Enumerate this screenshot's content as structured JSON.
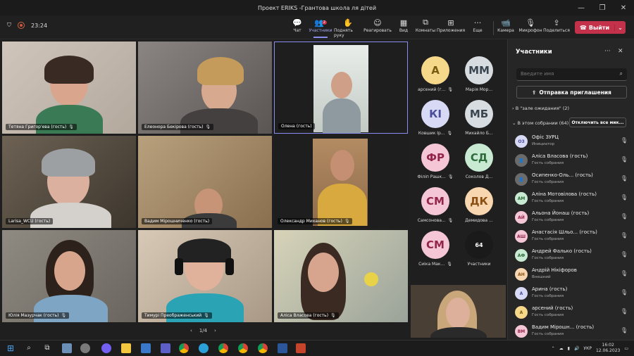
{
  "window": {
    "title": "Проект ERIKS -Грантова школа ля дітей"
  },
  "toolbar": {
    "time": "23:24",
    "buttons": [
      {
        "label": "Чат",
        "icon": "chat-icon"
      },
      {
        "label": "Участники",
        "icon": "people-icon",
        "badge": "2"
      },
      {
        "label": "Поднять руку",
        "icon": "hand-icon"
      },
      {
        "label": "Реагировать",
        "icon": "smile-icon"
      },
      {
        "label": "Вид",
        "icon": "grid-icon"
      },
      {
        "label": "Комнаты",
        "icon": "rooms-icon"
      },
      {
        "label": "Приложения",
        "icon": "plus-icon"
      },
      {
        "label": "Еще",
        "icon": "more-icon"
      },
      {
        "label": "Камера",
        "icon": "camera-icon"
      },
      {
        "label": "Микрофон",
        "icon": "mic-icon"
      },
      {
        "label": "Поделиться",
        "icon": "share-icon"
      }
    ],
    "leave": "Выйти"
  },
  "tiles": [
    {
      "name": "Тетяна Григор'ева (гость)"
    },
    {
      "name": "Елеонора Бекірова (гость)"
    },
    {
      "name": "Олена (гость)"
    },
    {
      "name": "Larisa_WCU (гость)"
    },
    {
      "name": "Вадим Мірошниченко (гость)"
    },
    {
      "name": "Олександр Миханов (гость)"
    },
    {
      "name": "Юлія Мазурчак (гость)"
    },
    {
      "name": "Тимурі Преображенський"
    },
    {
      "name": "Аліса Власова (гость)"
    }
  ],
  "pager": {
    "label": "1/4"
  },
  "avatars": [
    {
      "initials": "А",
      "label": "арсений (г...",
      "bg": "#f6d88a",
      "fg": "#7a5a10"
    },
    {
      "initials": "ММ",
      "label": "Марія Мор...",
      "bg": "#d6dce0",
      "fg": "#3a4550"
    },
    {
      "initials": "КІ",
      "label": "Ковшик Ір...",
      "bg": "#d7d9f5",
      "fg": "#4b4f9a"
    },
    {
      "initials": "МБ",
      "label": "Михайло Б...",
      "bg": "#d6dce0",
      "fg": "#3a4550"
    },
    {
      "initials": "ФР",
      "label": "Філіп Рашк...",
      "bg": "#f5c7d6",
      "fg": "#93244a"
    },
    {
      "initials": "СД",
      "label": "Соколов Д...",
      "bg": "#c9ead2",
      "fg": "#2e6b3c"
    },
    {
      "initials": "СМ",
      "label": "Самсонова...",
      "bg": "#f5c7d6",
      "fg": "#93244a"
    },
    {
      "initials": "ДК",
      "label": "Демидова ...",
      "bg": "#f7d6b0",
      "fg": "#8a4f12"
    },
    {
      "initials": "СМ",
      "label": "Сиіка Мак...",
      "bg": "#f5c7d6",
      "fg": "#93244a"
    },
    {
      "initials": "64",
      "label": "Участники",
      "bg": "#1a1a1a",
      "fg": "#ffffff"
    }
  ],
  "panel": {
    "title": "Участники",
    "search_placeholder": "Введите имя",
    "invite": "Отправка приглашения",
    "lobby": "В \"зале ожидания\" (2)",
    "inmeeting": "В этом собрании (64)",
    "muteall": "Отключить все мик...",
    "people": [
      {
        "initials": "ОЗ",
        "name": "Офіс ЗУРЦ",
        "role": "Инициатор",
        "bg": "#d7d9f5",
        "fg": "#4b4f9a"
      },
      {
        "initials": "",
        "name": "Аліса Власова (гость)",
        "role": "Гость собрания",
        "bg": "#6b6b6b",
        "fg": "#fff"
      },
      {
        "initials": "",
        "name": "Осипенко-Оль...  (гость)",
        "role": "Гость собрания",
        "bg": "#6b6b6b",
        "fg": "#fff"
      },
      {
        "initials": "АМ",
        "name": "Аліна Мотовілова (гость)",
        "role": "Гость собрания",
        "bg": "#c9ead2",
        "fg": "#2e6b3c"
      },
      {
        "initials": "АЙ",
        "name": "Альона Йонаш (гость)",
        "role": "Гость собрания",
        "bg": "#f5c7d6",
        "fg": "#93244a"
      },
      {
        "initials": "АШ",
        "name": "Анастасія Шльо... (гость)",
        "role": "Гость собрания",
        "bg": "#f5c7d6",
        "fg": "#93244a"
      },
      {
        "initials": "АФ",
        "name": "Андрей Фалько (гость)",
        "role": "Гость собрания",
        "bg": "#c9ead2",
        "fg": "#2e6b3c"
      },
      {
        "initials": "АН",
        "name": "Андрій Нікіфоров",
        "role": "Внешний",
        "bg": "#f7d6b0",
        "fg": "#8a4f12"
      },
      {
        "initials": "А",
        "name": "Арина (гость)",
        "role": "Гость собрания",
        "bg": "#d7d9f5",
        "fg": "#4b4f9a"
      },
      {
        "initials": "А",
        "name": "арсений (гость)",
        "role": "Гость собрания",
        "bg": "#f6d88a",
        "fg": "#7a5a10"
      },
      {
        "initials": "ВМ",
        "name": "Вадим Мірошн... (гость)",
        "role": "Гость собрания",
        "bg": "#f5c7d6",
        "fg": "#93244a"
      }
    ]
  },
  "taskbar": {
    "lang": "УКР",
    "time": "16:02",
    "date": "12.06.2023"
  }
}
